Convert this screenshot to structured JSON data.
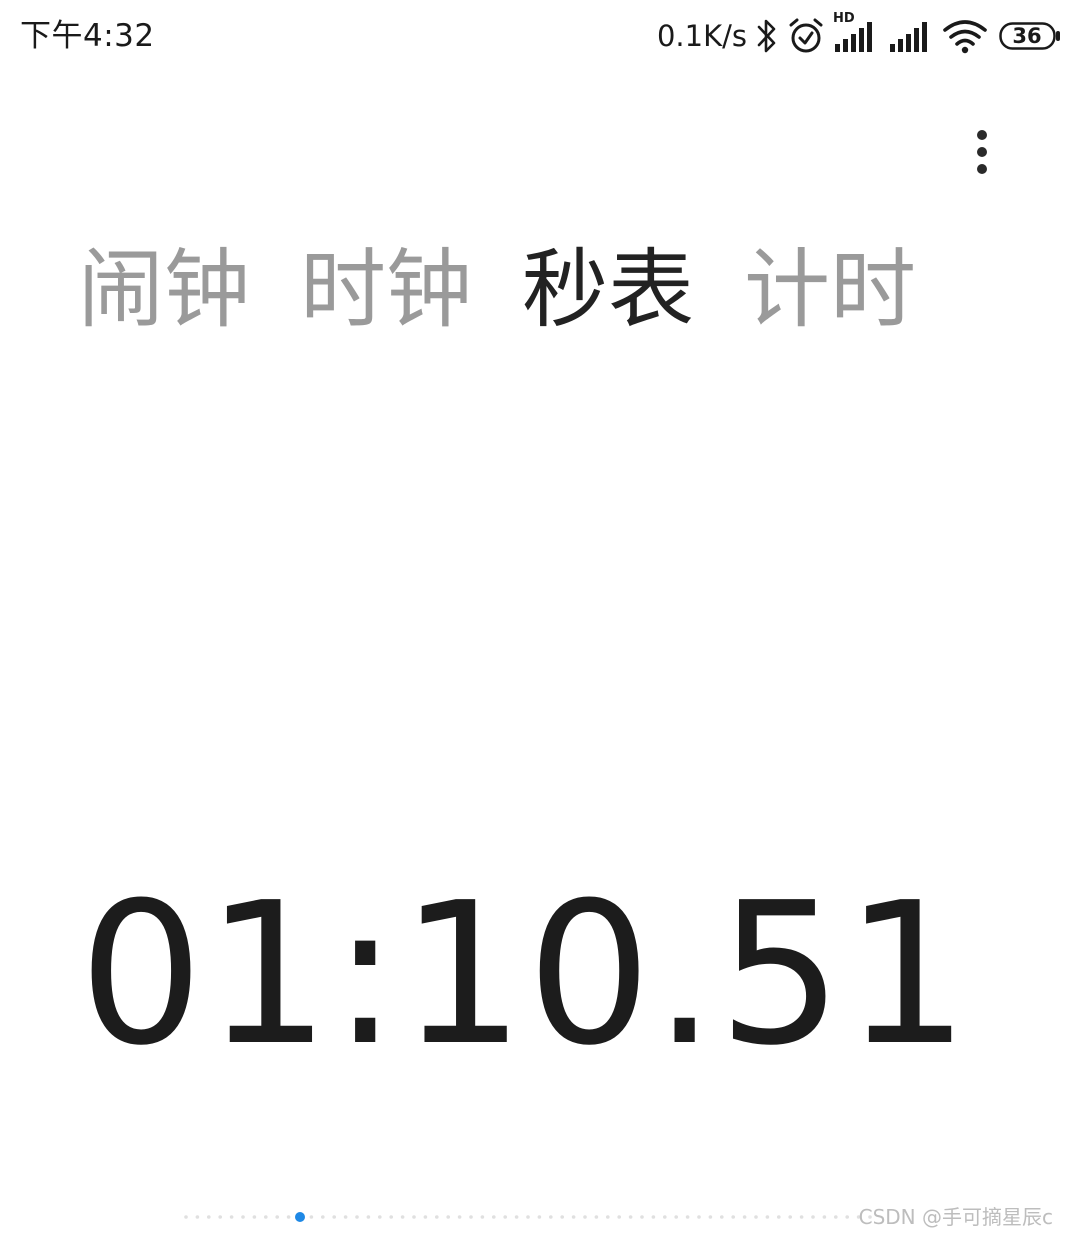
{
  "status_bar": {
    "time": "下午4:32",
    "net_speed": "0.1K/s",
    "icons": [
      "bluetooth-icon",
      "alarm-icon",
      "hd-signal-icon",
      "signal-icon",
      "wifi-icon",
      "battery-icon"
    ],
    "hd_label": "HD",
    "battery_level": "36"
  },
  "menu": {
    "icon": "more-vertical-icon"
  },
  "tabs": [
    {
      "label": "闹钟",
      "active": false
    },
    {
      "label": "时钟",
      "active": false
    },
    {
      "label": "秒表",
      "active": true
    },
    {
      "label": "计时",
      "active": false
    }
  ],
  "stopwatch": {
    "elapsed": "01:10.51"
  },
  "scale_indicator": {
    "current_fraction": 0.17,
    "accent_color": "#1e88e5",
    "tick_color": "#e0e0e0"
  },
  "watermark": "CSDN @手可摘星辰c"
}
